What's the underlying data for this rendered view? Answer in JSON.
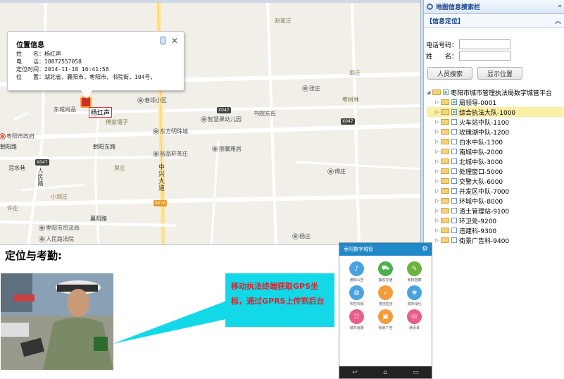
{
  "map": {
    "pois": [
      {
        "id": "zhaoxian",
        "label": "赵家庄",
        "dot": false,
        "area": true
      },
      {
        "id": "yizhuang",
        "label": "邱庄",
        "dot": false,
        "area": true
      },
      {
        "id": "zhangzhuang",
        "label": "张庄",
        "dot": true,
        "area": false
      },
      {
        "id": "zaoshulin",
        "label": "枣树林",
        "dot": false,
        "area": true
      },
      {
        "id": "dongcheng",
        "label": "东城尚品",
        "dot": false,
        "area": false
      },
      {
        "id": "chunsong",
        "label": "春颂小区",
        "dot": true,
        "area": false
      },
      {
        "id": "shuyuandong",
        "label": "书院东街",
        "dot": false,
        "area": false
      },
      {
        "id": "fujia",
        "label": "傅家堰子",
        "dot": false,
        "area": true
      },
      {
        "id": "zhihui",
        "label": "智慧果幼儿园",
        "dot": true,
        "area": false
      },
      {
        "id": "zhengfu",
        "label": "枣阳市政府",
        "dot": true,
        "red": true,
        "area": false
      },
      {
        "id": "dongfang",
        "label": "东方明珠城",
        "dot": true,
        "area": false
      },
      {
        "id": "chaoyangr",
        "label": "朝阳路",
        "dot": false,
        "area": false
      },
      {
        "id": "chaoyangdong",
        "label": "朝阳东路",
        "dot": false,
        "area": false
      },
      {
        "id": "yupin",
        "label": "裕品轩茶庄",
        "dot": true,
        "area": false
      },
      {
        "id": "lijing",
        "label": "丽馨雅居",
        "dot": true,
        "area": false
      },
      {
        "id": "yanshui",
        "label": "沮水巷",
        "dot": false,
        "area": false
      },
      {
        "id": "renminlu",
        "label": "人民路",
        "dot": false,
        "area": false
      },
      {
        "id": "wuzhuang",
        "label": "吴庄",
        "dot": false,
        "area": true
      },
      {
        "id": "zhongxing",
        "label": "中兴大道",
        "dot": false,
        "area": false
      },
      {
        "id": "fuzhuang",
        "label": "傅庄",
        "dot": true,
        "area": false
      },
      {
        "id": "xiaozheng",
        "label": "小郑庄",
        "dot": false,
        "area": true
      },
      {
        "id": "xuzhuang",
        "label": "许庄",
        "dot": false,
        "area": true
      },
      {
        "id": "xiangyang",
        "label": "襄阳路",
        "dot": false,
        "area": false
      },
      {
        "id": "sifa",
        "label": "枣阳市司法局",
        "dot": true,
        "area": false
      },
      {
        "id": "fayuan",
        "label": "人民路法院",
        "dot": true,
        "area": false
      },
      {
        "id": "yangzhuang",
        "label": "杨庄",
        "dot": true,
        "area": false
      }
    ],
    "shields": [
      {
        "id": "x047a",
        "label": "X047"
      },
      {
        "id": "x047b",
        "label": "X047"
      },
      {
        "id": "x047c",
        "label": "X047"
      },
      {
        "id": "s216",
        "label": "S216"
      }
    ],
    "marker_label": "杨红声"
  },
  "popup": {
    "title": "位置信息",
    "rows": [
      {
        "label": "姓　　名：",
        "value": "杨红声"
      },
      {
        "label": "电　　话：",
        "value": "18872557058"
      },
      {
        "label": "定位时间：",
        "value": "2014-11-18 16:41:58"
      },
      {
        "label": "位　　置：",
        "value": "湖北省，襄阳市，枣阳市，书院街，104号，"
      }
    ],
    "close": "✕"
  },
  "panel": {
    "title": "地图信息搜索栏",
    "collapse": "»",
    "section": "【信息定位】",
    "section_toggle": "︽",
    "phone_label": "电话号码：",
    "name_label": "姓　　名：",
    "phone_value": "",
    "name_value": "",
    "btn_search": "人员搜索",
    "btn_show": "显示位置",
    "tree": [
      {
        "label": "枣阳市城市管理执法局数字城管平台",
        "level": 0,
        "check": "part",
        "arrow": "◢",
        "sel": false
      },
      {
        "label": "局领导-0001",
        "level": 1,
        "check": "part",
        "arrow": "▷",
        "sel": false
      },
      {
        "label": "综合执法大队-1000",
        "level": 1,
        "check": "part",
        "arrow": "▷",
        "sel": true
      },
      {
        "label": "火车站中队-1100",
        "level": 1,
        "check": "none",
        "arrow": "▷",
        "sel": false
      },
      {
        "label": "玫瑰湖中队-1200",
        "level": 1,
        "check": "none",
        "arrow": "▷",
        "sel": false
      },
      {
        "label": "白水中队-1300",
        "level": 1,
        "check": "none",
        "arrow": "▷",
        "sel": false
      },
      {
        "label": "南城中队-2000",
        "level": 1,
        "check": "none",
        "arrow": "▷",
        "sel": false
      },
      {
        "label": "北城中队-3000",
        "level": 1,
        "check": "none",
        "arrow": "▷",
        "sel": false
      },
      {
        "label": "处理窗口-5000",
        "level": 1,
        "check": "none",
        "arrow": "▷",
        "sel": false
      },
      {
        "label": "交警大队-6000",
        "level": 1,
        "check": "none",
        "arrow": "▷",
        "sel": false
      },
      {
        "label": "开发区中队-7000",
        "level": 1,
        "check": "none",
        "arrow": "▷",
        "sel": false
      },
      {
        "label": "环城中队-8000",
        "level": 1,
        "check": "none",
        "arrow": "▷",
        "sel": false
      },
      {
        "label": "渣土管理站-9100",
        "level": 1,
        "check": "none",
        "arrow": "▷",
        "sel": false
      },
      {
        "label": "环卫处-9200",
        "level": 1,
        "check": "none",
        "arrow": "▷",
        "sel": false
      },
      {
        "label": "违建科-9300",
        "level": 1,
        "check": "none",
        "arrow": "▷",
        "sel": false
      },
      {
        "label": "街景广告科-9400",
        "level": 1,
        "check": "none",
        "arrow": "▷",
        "sel": false
      }
    ]
  },
  "bottom": {
    "headline": "定位与考勤:",
    "callout": "移动执法终端获取GPS坐标，通过GPRS上传到后台",
    "phone_app": {
      "title": "枣阳数字城管",
      "apps": [
        {
          "label": "通知公告",
          "color": "#4aa3df"
        },
        {
          "label": "静态交通",
          "color": "#4caf50"
        },
        {
          "label": "考核督察",
          "color": "#6cb33f"
        },
        {
          "label": "市容市貌",
          "color": "#4aa3df"
        },
        {
          "label": "渣违控违",
          "color": "#f39c3c"
        },
        {
          "label": "城市绿化",
          "color": "#4aa3df"
        },
        {
          "label": "城市道路",
          "color": "#e85d8a"
        },
        {
          "label": "街景广告",
          "color": "#f39c3c"
        },
        {
          "label": "通讯录",
          "color": "#e85d8a"
        }
      ]
    }
  },
  "colors": {
    "accent": "#15428b",
    "callout": "#13d8e8",
    "callout_text": "#d8262e",
    "phone_header": "#1e88c8"
  }
}
